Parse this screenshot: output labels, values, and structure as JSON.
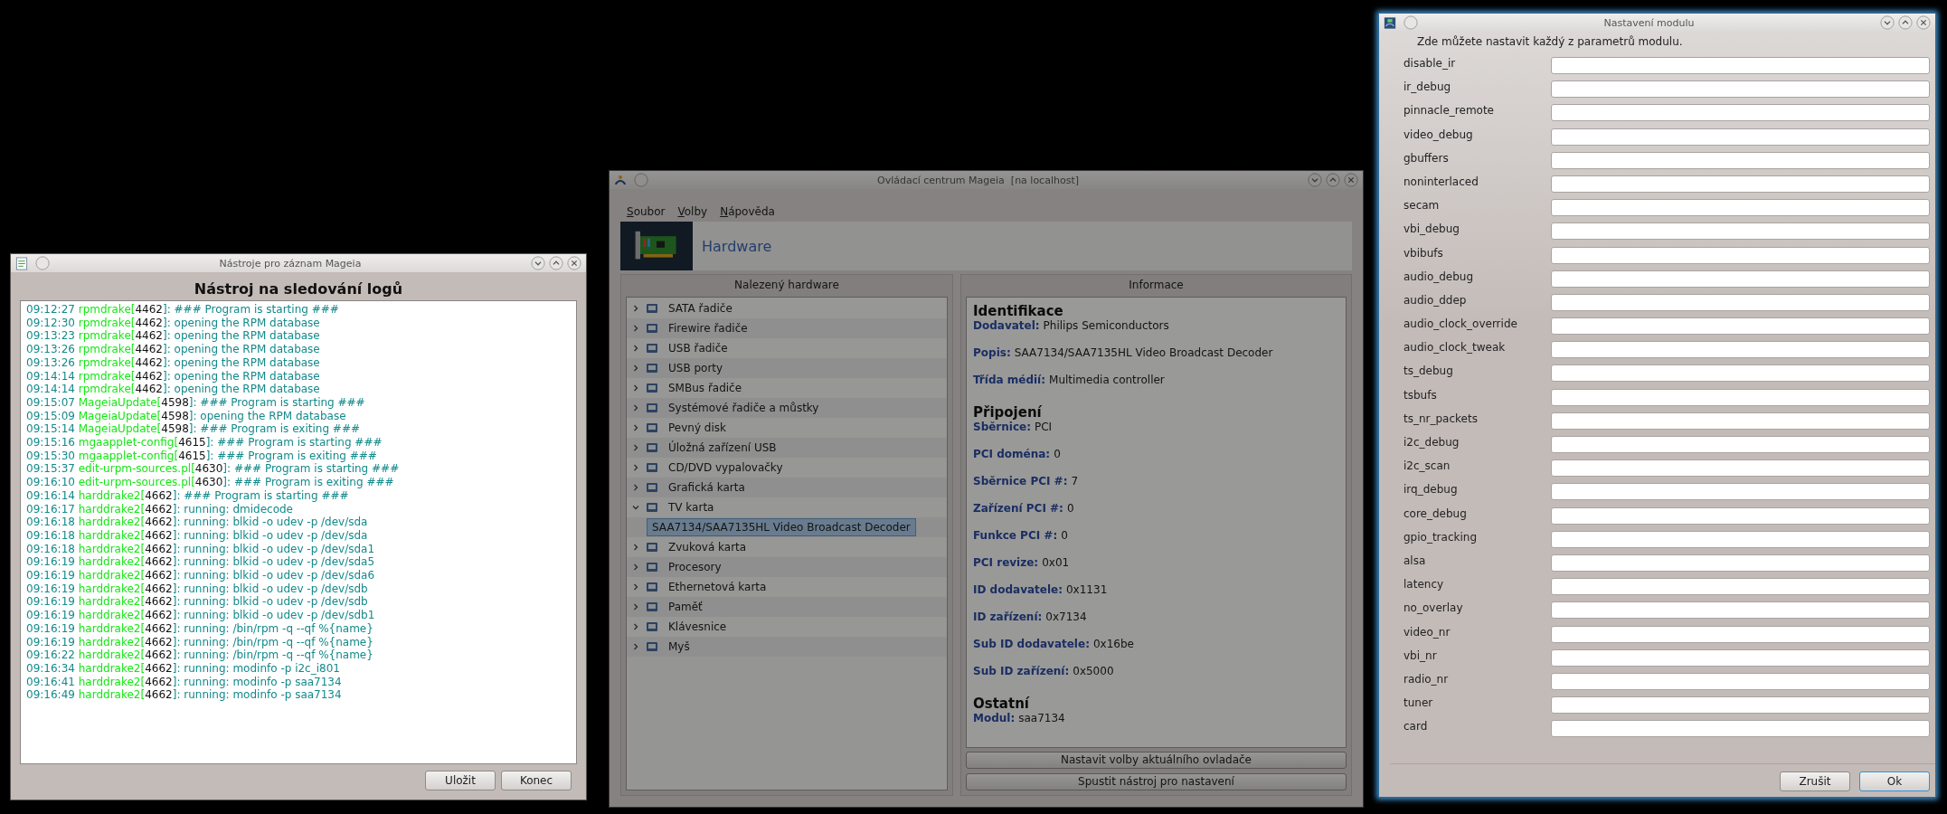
{
  "log_window": {
    "title": "Nástroje pro záznam Mageia",
    "active": false,
    "heading": "Nástroj na sledování logů",
    "lines": [
      {
        "time": "09:12:27",
        "program": "rpmdrake[",
        "pid": "4462",
        "message": "]: ### Program is starting ###"
      },
      {
        "time": "09:12:30",
        "program": "rpmdrake[",
        "pid": "4462",
        "message": "]: opening the RPM database"
      },
      {
        "time": "09:13:23",
        "program": "rpmdrake[",
        "pid": "4462",
        "message": "]: opening the RPM database"
      },
      {
        "time": "09:13:26",
        "program": "rpmdrake[",
        "pid": "4462",
        "message": "]: opening the RPM database"
      },
      {
        "time": "09:13:26",
        "program": "rpmdrake[",
        "pid": "4462",
        "message": "]: opening the RPM database"
      },
      {
        "time": "09:14:14",
        "program": "rpmdrake[",
        "pid": "4462",
        "message": "]: opening the RPM database"
      },
      {
        "time": "09:14:14",
        "program": "rpmdrake[",
        "pid": "4462",
        "message": "]: opening the RPM database"
      },
      {
        "time": "09:15:07",
        "program": "MageiaUpdate[",
        "pid": "4598",
        "message": "]: ### Program is starting ###"
      },
      {
        "time": "09:15:09",
        "program": "MageiaUpdate[",
        "pid": "4598",
        "message": "]: opening the RPM database"
      },
      {
        "time": "09:15:14",
        "program": "MageiaUpdate[",
        "pid": "4598",
        "message": "]: ### Program is exiting ###"
      },
      {
        "time": "09:15:16",
        "program": "mgaapplet-config[",
        "pid": "4615",
        "message": "]: ### Program is starting ###"
      },
      {
        "time": "09:15:30",
        "program": "mgaapplet-config[",
        "pid": "4615",
        "message": "]: ### Program is exiting ###"
      },
      {
        "time": "09:15:37",
        "program": "edit-urpm-sources.pl[",
        "pid": "4630",
        "message": "]: ### Program is starting ###"
      },
      {
        "time": "09:16:10",
        "program": "edit-urpm-sources.pl[",
        "pid": "4630",
        "message": "]: ### Program is exiting ###"
      },
      {
        "time": "09:16:14",
        "program": "harddrake2[",
        "pid": "4662",
        "message": "]: ### Program is starting ###"
      },
      {
        "time": "09:16:17",
        "program": "harddrake2[",
        "pid": "4662",
        "message": "]: running: dmidecode"
      },
      {
        "time": "09:16:18",
        "program": "harddrake2[",
        "pid": "4662",
        "message": "]: running: blkid -o udev -p /dev/sda"
      },
      {
        "time": "09:16:18",
        "program": "harddrake2[",
        "pid": "4662",
        "message": "]: running: blkid -o udev -p /dev/sda"
      },
      {
        "time": "09:16:18",
        "program": "harddrake2[",
        "pid": "4662",
        "message": "]: running: blkid -o udev -p /dev/sda1"
      },
      {
        "time": "09:16:19",
        "program": "harddrake2[",
        "pid": "4662",
        "message": "]: running: blkid -o udev -p /dev/sda5"
      },
      {
        "time": "09:16:19",
        "program": "harddrake2[",
        "pid": "4662",
        "message": "]: running: blkid -o udev -p /dev/sda6"
      },
      {
        "time": "09:16:19",
        "program": "harddrake2[",
        "pid": "4662",
        "message": "]: running: blkid -o udev -p /dev/sdb"
      },
      {
        "time": "09:16:19",
        "program": "harddrake2[",
        "pid": "4662",
        "message": "]: running: blkid -o udev -p /dev/sdb"
      },
      {
        "time": "09:16:19",
        "program": "harddrake2[",
        "pid": "4662",
        "message": "]: running: blkid -o udev -p /dev/sdb1"
      },
      {
        "time": "09:16:19",
        "program": "harddrake2[",
        "pid": "4662",
        "message": "]: running: /bin/rpm -q --qf %{name}"
      },
      {
        "time": "09:16:19",
        "program": "harddrake2[",
        "pid": "4662",
        "message": "]: running: /bin/rpm -q --qf %{name}"
      },
      {
        "time": "09:16:22",
        "program": "harddrake2[",
        "pid": "4662",
        "message": "]: running: /bin/rpm -q --qf %{name}"
      },
      {
        "time": "09:16:34",
        "program": "harddrake2[",
        "pid": "4662",
        "message": "]: running: modinfo -p i2c_i801"
      },
      {
        "time": "09:16:41",
        "program": "harddrake2[",
        "pid": "4662",
        "message": "]: running: modinfo -p saa7134"
      },
      {
        "time": "09:16:49",
        "program": "harddrake2[",
        "pid": "4662",
        "message": "]: running: modinfo -p saa7134"
      }
    ],
    "buttons": [
      "Uložit",
      "Konec"
    ]
  },
  "control_center": {
    "title": "Ovládací centrum Mageia  [na localhost]",
    "active": false,
    "dimmed": true,
    "menu": [
      "Soubor",
      "Volby",
      "Nápověda"
    ],
    "banner_title": "Hardware",
    "tree_header": "Nalezený hardware",
    "tree": [
      {
        "label": "SATA řadiče",
        "expanded": false,
        "selected": false
      },
      {
        "label": "Firewire řadiče",
        "expanded": false,
        "selected": false
      },
      {
        "label": "USB řadiče",
        "expanded": false,
        "selected": false
      },
      {
        "label": "USB porty",
        "expanded": false,
        "selected": false
      },
      {
        "label": "SMBus řadiče",
        "expanded": false,
        "selected": false
      },
      {
        "label": "Systémové řadiče a můstky",
        "expanded": false,
        "selected": false
      },
      {
        "label": "Pevný disk",
        "expanded": false,
        "selected": false
      },
      {
        "label": "Úložná zařízení USB",
        "expanded": false,
        "selected": false
      },
      {
        "label": "CD/DVD vypalovačky",
        "expanded": false,
        "selected": false
      },
      {
        "label": "Grafická karta",
        "expanded": false,
        "selected": false
      },
      {
        "label": "TV karta",
        "expanded": true,
        "selected": false,
        "children": [
          {
            "label": "SAA7134/SAA7135HL Video Broadcast Decoder",
            "selected": true
          }
        ]
      },
      {
        "label": "Zvuková karta",
        "expanded": false,
        "selected": false
      },
      {
        "label": "Procesory",
        "expanded": false,
        "selected": false
      },
      {
        "label": "Ethernetová karta",
        "expanded": false,
        "selected": false
      },
      {
        "label": "Paměť",
        "expanded": false,
        "selected": false
      },
      {
        "label": "Klávesnice",
        "expanded": false,
        "selected": false
      },
      {
        "label": "Myš",
        "expanded": false,
        "selected": false
      }
    ],
    "info_header": "Informace",
    "info": [
      {
        "heading": "Identifikace",
        "fields": [
          {
            "label": "Dodavatel:",
            "value": "Philips Semiconductors"
          },
          {
            "label": "Popis:",
            "value": "SAA7134/SAA7135HL Video Broadcast Decoder"
          },
          {
            "label": "Třída médií:",
            "value": "Multimedia controller"
          }
        ]
      },
      {
        "heading": "Připojení",
        "fields": [
          {
            "label": "Sběrnice:",
            "value": "PCI"
          },
          {
            "label": "PCI doména:",
            "value": "0"
          },
          {
            "label": "Sběrnice PCI #:",
            "value": "7"
          },
          {
            "label": "Zařízení PCI #:",
            "value": "0"
          },
          {
            "label": "Funkce PCI #:",
            "value": "0"
          },
          {
            "label": "PCI revize:",
            "value": "0x01"
          },
          {
            "label": "ID dodavatele:",
            "value": "0x1131"
          },
          {
            "label": "ID zařízení:",
            "value": "0x7134"
          },
          {
            "label": "Sub ID dodavatele:",
            "value": "0x16be"
          },
          {
            "label": "Sub ID zařízení:",
            "value": "0x5000"
          }
        ]
      },
      {
        "heading": "Ostatní",
        "fields": [
          {
            "label": "Modul:",
            "value": "saa7134"
          }
        ]
      }
    ],
    "buttons": [
      "Nastavit volby aktuálního ovladače",
      "Spustit nástroj pro nastavení"
    ]
  },
  "module_dialog": {
    "title": "Nastavení modulu",
    "active": true,
    "intro": "Zde můžete nastavit každý z parametrů modulu.",
    "params": [
      "disable_ir",
      "ir_debug",
      "pinnacle_remote",
      "video_debug",
      "gbuffers",
      "noninterlaced",
      "secam",
      "vbi_debug",
      "vbibufs",
      "audio_debug",
      "audio_ddep",
      "audio_clock_override",
      "audio_clock_tweak",
      "ts_debug",
      "tsbufs",
      "ts_nr_packets",
      "i2c_debug",
      "i2c_scan",
      "irq_debug",
      "core_debug",
      "gpio_tracking",
      "alsa",
      "latency",
      "no_overlay",
      "video_nr",
      "vbi_nr",
      "radio_nr",
      "tuner",
      "card"
    ],
    "buttons": [
      {
        "label": "Zrušit",
        "focused": false
      },
      {
        "label": "Ok",
        "focused": true
      }
    ]
  }
}
